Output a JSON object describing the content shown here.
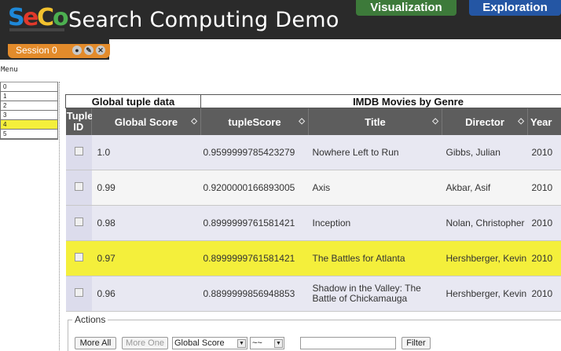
{
  "app": {
    "title": "Search Computing Demo",
    "logo_text": "SeCo"
  },
  "top_tabs": {
    "visualization": "Visualization",
    "exploration": "Exploration"
  },
  "session": {
    "label": "Session 0"
  },
  "menu": {
    "label": "Menu",
    "items": [
      "0",
      "1",
      "2",
      "3",
      "4",
      "5"
    ],
    "active_index": 4
  },
  "table": {
    "group_headers": {
      "global": "Global tuple data",
      "imdb": "IMDB Movies by Genre"
    },
    "columns": {
      "tuple_id": "Tuple ID",
      "global_score": "Global Score",
      "tuple_score": "tupleScore",
      "title": "Title",
      "director": "Director",
      "year": "Year"
    },
    "rows": [
      {
        "global_score": "1.0",
        "tuple_score": "0.9599999785423279",
        "title": "Nowhere Left to Run",
        "director": "Gibbs, Julian",
        "year": "2010"
      },
      {
        "global_score": "0.99",
        "tuple_score": "0.9200000166893005",
        "title": "Axis",
        "director": "Akbar, Asif",
        "year": "2010"
      },
      {
        "global_score": "0.98",
        "tuple_score": "0.8999999761581421",
        "title": "Inception",
        "director": "Nolan, Christopher",
        "year": "2010"
      },
      {
        "global_score": "0.97",
        "tuple_score": "0.8999999761581421",
        "title": "The Battles for Atlanta",
        "director": "Hershberger, Kevin",
        "year": "2010"
      },
      {
        "global_score": "0.96",
        "tuple_score": "0.8899999856948853",
        "title": "Shadow in the Valley: The Battle of Chickamauga",
        "director": "Hershberger, Kevin",
        "year": "2010"
      }
    ],
    "highlighted_row_index": 3
  },
  "actions": {
    "legend": "Actions",
    "more_all": "More All",
    "more_one": "More One",
    "sort_field": "Global Score",
    "operator": "~~",
    "filter_value": "",
    "filter_button": "Filter"
  },
  "colors": {
    "header_bg": "#2a2a2a",
    "session_tab": "#e38b2b",
    "visualization_tab": "#3d7a3a",
    "exploration_tab": "#2456a4",
    "highlight": "#f4ef3b",
    "column_header_bg": "#5d5d5d"
  }
}
